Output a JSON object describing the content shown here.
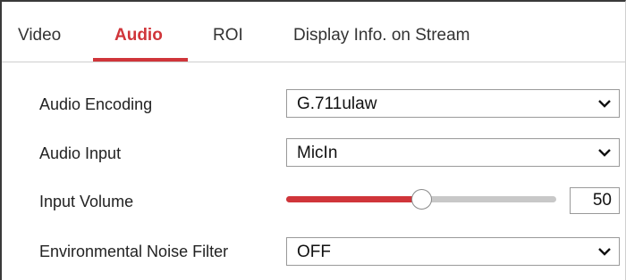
{
  "tabs": [
    {
      "label": "Video",
      "active": false
    },
    {
      "label": "Audio",
      "active": true
    },
    {
      "label": "ROI",
      "active": false
    },
    {
      "label": "Display Info. on Stream",
      "active": false
    }
  ],
  "accent_color": "#d0353a",
  "form": {
    "audio_encoding": {
      "label": "Audio Encoding",
      "value": "G.711ulaw"
    },
    "audio_input": {
      "label": "Audio Input",
      "value": "MicIn"
    },
    "input_volume": {
      "label": "Input Volume",
      "value": "50",
      "level_fraction": 0.5
    },
    "noise_filter": {
      "label": "Environmental Noise Filter",
      "value": "OFF"
    }
  },
  "icons": {
    "dropdown": "chevron-down-icon"
  }
}
